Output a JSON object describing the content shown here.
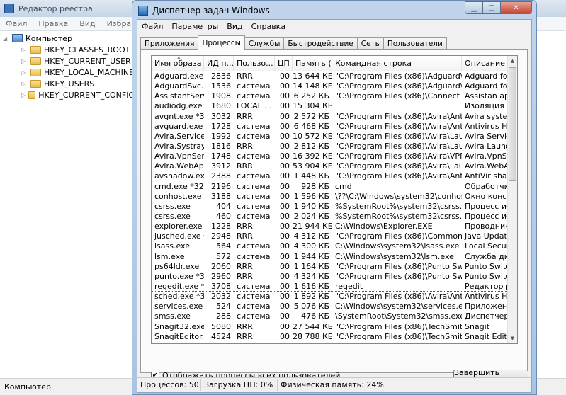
{
  "regedit": {
    "title": "Редактор реестра",
    "menu": [
      "Файл",
      "Правка",
      "Вид",
      "Избранное"
    ],
    "root": "Компьютер",
    "keys": [
      "HKEY_CLASSES_ROOT",
      "HKEY_CURRENT_USER",
      "HKEY_LOCAL_MACHINE",
      "HKEY_USERS",
      "HKEY_CURRENT_CONFIG"
    ],
    "status": "Компьютер"
  },
  "taskmgr": {
    "title": "Диспетчер задач Windows",
    "menu": [
      "Файл",
      "Параметры",
      "Вид",
      "Справка"
    ],
    "tabs": [
      "Приложения",
      "Процессы",
      "Службы",
      "Быстродействие",
      "Сеть",
      "Пользователи"
    ],
    "columns": [
      "Имя образа",
      "ИД п...",
      "Пользо...",
      "ЦП",
      "Память (...",
      "Командная строка",
      "Описание"
    ],
    "rows": [
      [
        "Adguard.exe *32",
        "2836",
        "RRR",
        "00",
        "13 644 КБ",
        "\"C:\\Program Files (x86)\\Adguard\\Adgua...",
        "Adguard for Wi"
      ],
      [
        "AdguardSvc.exe...",
        "1536",
        "система",
        "00",
        "14 148 КБ",
        "\"C:\\Program Files (x86)\\Adguard\\Adgua...",
        "Adguard for Wi"
      ],
      [
        "AssistantServi...",
        "1908",
        "система",
        "00",
        "6 252 КБ",
        "\"C:\\Program Files (x86)\\Connect Manag...",
        "Assistan applica"
      ],
      [
        "audiodg.exe",
        "1680",
        "LOCAL ...",
        "00",
        "15 304 КБ",
        "",
        "Изоляция граф"
      ],
      [
        "avgnt.exe *32",
        "3032",
        "RRR",
        "00",
        "2 572 КБ",
        "\"C:\\Program Files (x86)\\Avira\\Antivirus\\...",
        "Avira system tra"
      ],
      [
        "avguard.exe ...",
        "1728",
        "система",
        "00",
        "6 468 КБ",
        "\"C:\\Program Files (x86)\\Avira\\Antivirus\\...",
        "Antivirus Host F"
      ],
      [
        "Avira.Service...",
        "1992",
        "система",
        "00",
        "10 572 КБ",
        "\"C:\\Program Files (x86)\\Avira\\Launcher\\...",
        "Avira Service Ho"
      ],
      [
        "Avira.Systray...",
        "1816",
        "RRR",
        "00",
        "2 812 КБ",
        "\"C:\\Program Files (x86)\\Avira\\Launcher\\...",
        "Avira Launcher"
      ],
      [
        "Avira.VpnServ...",
        "1748",
        "система",
        "00",
        "16 392 КБ",
        "\"C:\\Program Files (x86)\\Avira\\VPN\\Avira...",
        "Avira.VpnServic"
      ],
      [
        "Avira.WebApp...",
        "3912",
        "RRR",
        "00",
        "53 904 КБ",
        "\"C:\\Program Files (x86)\\Avira\\Launcher\\...",
        "Avira.WebAppH"
      ],
      [
        "avshadow.exe",
        "2388",
        "система",
        "00",
        "1 448 КБ",
        "\"C:\\Program Files (x86)\\Avira\\Antivirus\\...",
        "AntiVir shadow c"
      ],
      [
        "cmd.exe *32",
        "2196",
        "система",
        "00",
        "928 КБ",
        "cmd",
        "Обработчик ком"
      ],
      [
        "conhost.exe",
        "3188",
        "система",
        "00",
        "1 596 КБ",
        "\\??\\C:\\Windows\\system32\\conhost.exe ...",
        "Окно консоли у"
      ],
      [
        "csrss.exe",
        "404",
        "система",
        "00",
        "1 940 КБ",
        "%SystemRoot%\\system32\\csrss.exe O...",
        "Процесс испол"
      ],
      [
        "csrss.exe",
        "460",
        "система",
        "00",
        "2 024 КБ",
        "%SystemRoot%\\system32\\csrss.exe O...",
        "Процесс испол"
      ],
      [
        "explorer.exe",
        "1228",
        "RRR",
        "00",
        "21 944 КБ",
        "C:\\Windows\\Explorer.EXE",
        "Проводник"
      ],
      [
        "jusched.exe *32",
        "2948",
        "RRR",
        "00",
        "4 312 КБ",
        "\"C:\\Program Files (x86)\\Common Files\\J...",
        "Java Update Sc"
      ],
      [
        "lsass.exe",
        "564",
        "система",
        "00",
        "4 300 КБ",
        "C:\\Windows\\system32\\lsass.exe",
        "Local Security A"
      ],
      [
        "lsm.exe",
        "572",
        "система",
        "00",
        "1 944 КБ",
        "C:\\Windows\\system32\\lsm.exe",
        "Служба диспет"
      ],
      [
        "ps64ldr.exe",
        "2060",
        "RRR",
        "00",
        "1 164 КБ",
        "\"C:\\Program Files (x86)\\Punto Switcher\\...",
        "Punto Switcher"
      ],
      [
        "punto.exe *32",
        "2960",
        "RRR",
        "00",
        "4 324 КБ",
        "\"C:\\Program Files (x86)\\Punto Switcher\\...",
        "Punto Switcher"
      ],
      [
        "regedit.exe *32",
        "3708",
        "система",
        "00",
        "1 616 КБ",
        "regedit",
        "Редактор реест"
      ],
      [
        "sched.exe *32",
        "2032",
        "система",
        "00",
        "1 892 КБ",
        "\"C:\\Program Files (x86)\\Avira\\Antivirus\\...",
        "Antivirus Host F"
      ],
      [
        "services.exe",
        "524",
        "система",
        "00",
        "5 076 КБ",
        "C:\\Windows\\system32\\services.exe",
        "Приложение слу"
      ],
      [
        "smss.exe",
        "288",
        "система",
        "00",
        "476 КБ",
        "\\SystemRoot\\System32\\smss.exe",
        "Диспетчер сеа"
      ],
      [
        "Snagit32.exe ...",
        "5080",
        "RRR",
        "00",
        "27 544 КБ",
        "\"C:\\Program Files (x86)\\TechSmith\\Snag...",
        "Snagit"
      ],
      [
        "SnagitEditor.e...",
        "4524",
        "RRR",
        "00",
        "28 788 КБ",
        "\"C:\\Program Files (x86)\\TechSmith\\Snag...",
        "Snagit Editor"
      ]
    ],
    "show_all_label": "Отображать процессы всех пользователей",
    "end_process": "Завершить процесс",
    "status": {
      "processes": "Процессов: 50",
      "cpu": "Загрузка ЦП: 0%",
      "memory": "Физическая память: 24%"
    }
  }
}
